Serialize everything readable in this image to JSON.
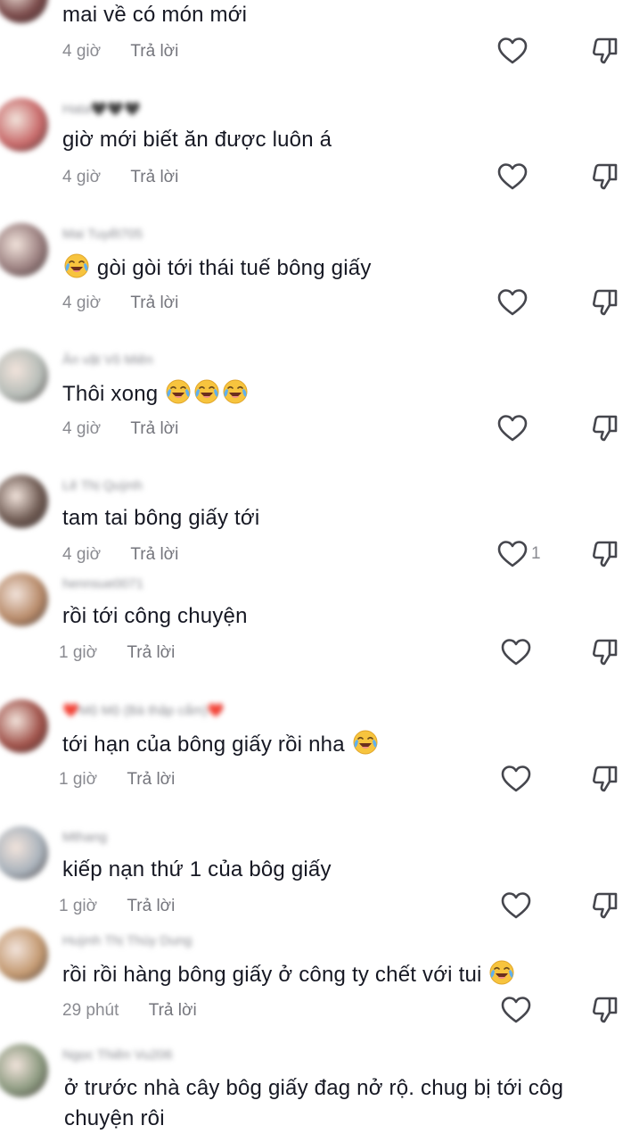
{
  "comments": [
    {
      "username": "",
      "text": "mai về có món mới",
      "time": "4 giờ",
      "reply_label": "Trả lời",
      "like_count": "",
      "avatar_color": "#7a4a4a"
    },
    {
      "username": "Hata🖤🖤🖤",
      "text": "giờ mới biết ăn được luôn á",
      "time": "4 giờ",
      "reply_label": "Trả lời",
      "like_count": "",
      "avatar_color": "#c86a6a"
    },
    {
      "username": "Mai Tuyết705",
      "text": "😂 gòi gòi tới thái tuế bông giấy",
      "time": "4 giờ",
      "reply_label": "Trả lời",
      "like_count": "",
      "avatar_color": "#9a7f7f"
    },
    {
      "username": "Ăn vặt Vô Miên",
      "text": "Thôi xong 😂😂😂",
      "time": "4 giờ",
      "reply_label": "Trả lời",
      "like_count": "",
      "avatar_color": "#b7bdb8"
    },
    {
      "username": "Lê Thị Quỳnh",
      "text": "tam tai bông giấy tới",
      "time": "4 giờ",
      "reply_label": "Trả lời",
      "like_count": "1",
      "avatar_color": "#6e5a52"
    },
    {
      "username": "hennsue0071",
      "text": "rồi tới công chuyện",
      "time": "1 giờ",
      "reply_label": "Trả lời",
      "like_count": "",
      "avatar_color": "#b88b6a"
    },
    {
      "username": "❤️Mộ Mộ (Bà thập cẩm)❤️",
      "text": "tới hạn của bông giấy rồi nha 😂",
      "time": "1 giờ",
      "reply_label": "Trả lời",
      "like_count": "",
      "avatar_color": "#a0524a"
    },
    {
      "username": "Mthang",
      "text": "kiếp nạn thứ 1 của bôg giấy",
      "time": "1 giờ",
      "reply_label": "Trả lời",
      "like_count": "",
      "avatar_color": "#aab3bc"
    },
    {
      "username": "Huỳnh Thị Thúy Dung",
      "text": "rồi rồi hàng bông giấy ở công ty chết với tui 😂",
      "time": "29 phút",
      "reply_label": "Trả lời",
      "like_count": "",
      "avatar_color": "#c49a72"
    },
    {
      "username": "Ngọc Thiên Vu206",
      "text": "ở trước nhà cây bôg giấy đag nở rộ. chug bị tới côg chuyện rôi",
      "time": "",
      "reply_label": "",
      "like_count": "",
      "avatar_color": "#8c9a80"
    }
  ]
}
